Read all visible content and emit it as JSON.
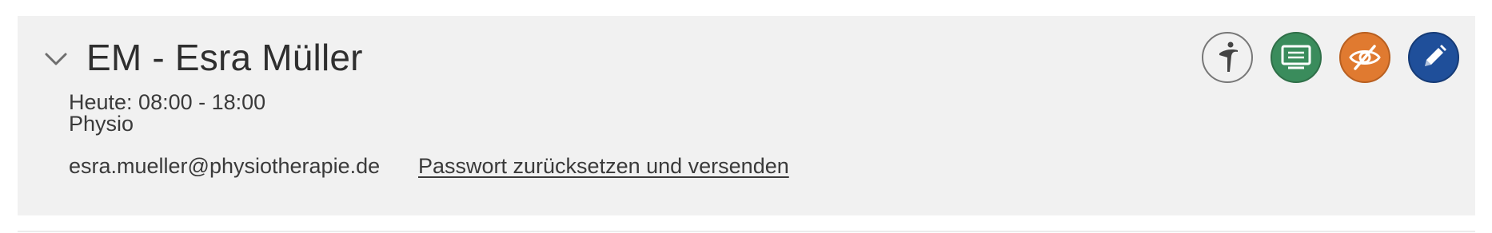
{
  "employee": {
    "title": "EM - Esra Müller",
    "hours": "Heute: 08:00 - 18:00",
    "role": "Physio",
    "email": "esra.mueller@physiotherapie.de",
    "reset_link": "Passwort zurücksetzen und versenden"
  },
  "actions": [
    {
      "name": "person-icon",
      "color": "#f1f1f1"
    },
    {
      "name": "notes-icon",
      "color": "#3a8c5c"
    },
    {
      "name": "eye-slash-icon",
      "color": "#e07a30"
    },
    {
      "name": "pencil-icon",
      "color": "#1f4f9a"
    }
  ],
  "colors": {
    "card_background": "#f1f1f1",
    "text": "#3a3a3a"
  }
}
